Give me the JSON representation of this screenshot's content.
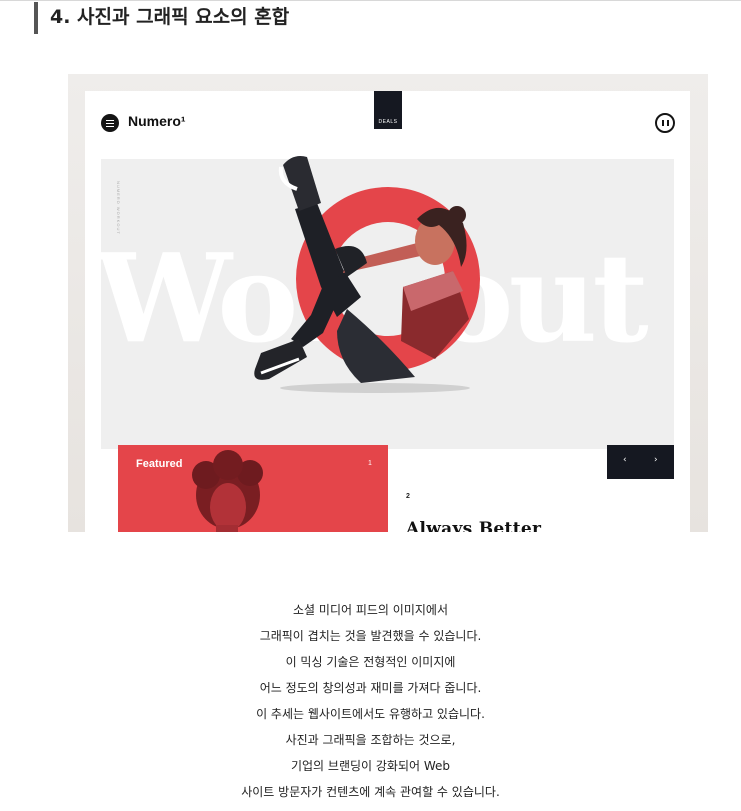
{
  "section": {
    "title": "4. 사진과 그래픽 요소의 혼합"
  },
  "mockup": {
    "brand": "Numero¹",
    "deals_label": "DEALS",
    "hero_word": "Workout",
    "side_caption": "NUMERO WORKOUT",
    "featured": {
      "label": "Featured",
      "number": "1"
    },
    "slide": {
      "number": "2",
      "title": "Always Better"
    },
    "arrows": {
      "prev": "‹",
      "next": "›"
    },
    "icons": [
      "menu-icon",
      "pause-icon",
      "chevron-left-icon",
      "chevron-right-icon"
    ],
    "colors": {
      "accent_red": "#e4454a",
      "dark_navy": "#151821",
      "hero_bg": "#efefef",
      "frame_bg": "#e9e6e3"
    }
  },
  "body": {
    "lines": [
      "소셜 미디어 피드의 이미지에서",
      "그래픽이 겹치는 것을 발견했을 수 있습니다.",
      "이 믹싱 기술은 전형적인 이미지에",
      "어느 정도의 창의성과 재미를 가져다 줍니다.",
      "이 추세는 웹사이트에서도 유행하고 있습니다.",
      "사진과 그래픽을 조합하는 것으로,",
      "기업의 브랜딩이 강화되어 Web",
      "사이트 방문자가 컨텐츠에 계속 관여할 수 있습니다."
    ]
  }
}
